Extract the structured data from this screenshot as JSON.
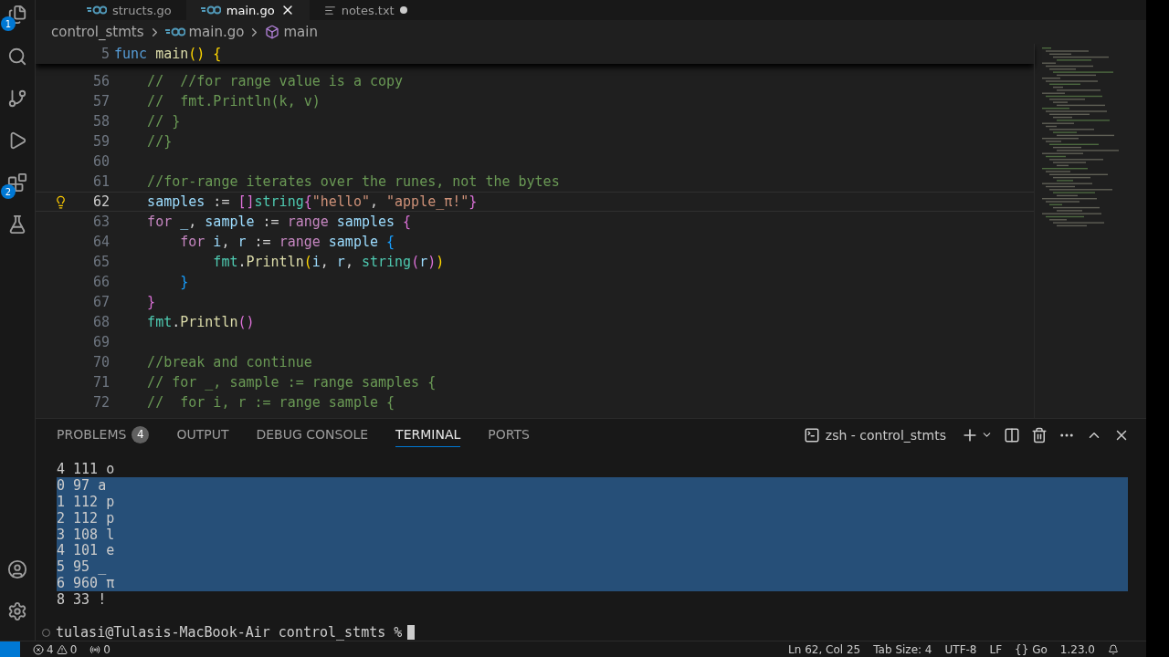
{
  "editor_tabs": [
    {
      "label": "structs.go",
      "kind": "go",
      "selected": false,
      "modified": false
    },
    {
      "label": "main.go",
      "kind": "go",
      "selected": true,
      "modified": false
    },
    {
      "label": "notes.txt",
      "kind": "text",
      "selected": false,
      "modified": true
    }
  ],
  "activity_bar": {
    "explorer_badge": "1",
    "extensions_badge": "2"
  },
  "breadcrumbs": [
    {
      "label": "control_stmts",
      "kind": "folder"
    },
    {
      "label": "main.go",
      "kind": "go"
    },
    {
      "label": "main",
      "kind": "symbol"
    }
  ],
  "sticky_line": {
    "number": "5",
    "tokens": [
      {
        "text": "func",
        "kind": "keyword"
      },
      {
        "text": " main",
        "kind": "function"
      },
      {
        "text": "()",
        "kind": "bracket1"
      },
      {
        "text": " {",
        "kind": "bracket1"
      }
    ]
  },
  "code_lines": [
    {
      "number": "56",
      "current": false,
      "tokens": [
        {
          "text": "    //  //for range value is a copy",
          "kind": "comment"
        }
      ]
    },
    {
      "number": "57",
      "current": false,
      "tokens": [
        {
          "text": "    //  fmt.Println(k, v)",
          "kind": "comment"
        }
      ]
    },
    {
      "number": "58",
      "current": false,
      "tokens": [
        {
          "text": "    // }",
          "kind": "comment"
        }
      ]
    },
    {
      "number": "59",
      "current": false,
      "tokens": [
        {
          "text": "    //}",
          "kind": "comment"
        }
      ]
    },
    {
      "number": "60",
      "current": false
    },
    {
      "number": "61",
      "current": false,
      "tokens": [
        {
          "text": "    //for-range iterates over the runes, not the bytes",
          "kind": "comment"
        }
      ]
    },
    {
      "number": "62",
      "current": true,
      "tokens": [
        {
          "text": "    samples",
          "kind": "variable"
        },
        {
          "text": " := ",
          "kind": "plain"
        },
        {
          "text": "[]",
          "kind": "bracket2"
        },
        {
          "text": "string",
          "kind": "type"
        },
        {
          "text": "{",
          "kind": "bracket2"
        },
        {
          "text": "\"hello\"",
          "kind": "string"
        },
        {
          "text": ", ",
          "kind": "plain"
        },
        {
          "text": "\"apple_π!\"",
          "kind": "string"
        },
        {
          "text": "}",
          "kind": "bracket2"
        }
      ]
    },
    {
      "number": "63",
      "current": false,
      "tokens": [
        {
          "text": "    for",
          "kind": "control"
        },
        {
          "text": " _",
          "kind": "variable"
        },
        {
          "text": ", ",
          "kind": "plain"
        },
        {
          "text": "sample",
          "kind": "variable"
        },
        {
          "text": " := ",
          "kind": "plain"
        },
        {
          "text": "range",
          "kind": "control"
        },
        {
          "text": " samples",
          "kind": "variable"
        },
        {
          "text": " {",
          "kind": "bracket2"
        }
      ]
    },
    {
      "number": "64",
      "current": false,
      "tokens": [
        {
          "text": "        for",
          "kind": "control"
        },
        {
          "text": " i",
          "kind": "variable"
        },
        {
          "text": ", ",
          "kind": "plain"
        },
        {
          "text": "r",
          "kind": "variable"
        },
        {
          "text": " := ",
          "kind": "plain"
        },
        {
          "text": "range",
          "kind": "control"
        },
        {
          "text": " sample",
          "kind": "variable"
        },
        {
          "text": " {",
          "kind": "bracket3"
        }
      ]
    },
    {
      "number": "65",
      "current": false,
      "tokens": [
        {
          "text": "            fmt",
          "kind": "type"
        },
        {
          "text": ".",
          "kind": "plain"
        },
        {
          "text": "Println",
          "kind": "function"
        },
        {
          "text": "(",
          "kind": "bracket1"
        },
        {
          "text": "i",
          "kind": "variable"
        },
        {
          "text": ", ",
          "kind": "plain"
        },
        {
          "text": "r",
          "kind": "variable"
        },
        {
          "text": ", ",
          "kind": "plain"
        },
        {
          "text": "string",
          "kind": "type"
        },
        {
          "text": "(",
          "kind": "bracket2"
        },
        {
          "text": "r",
          "kind": "variable"
        },
        {
          "text": ")",
          "kind": "bracket2"
        },
        {
          "text": ")",
          "kind": "bracket1"
        }
      ]
    },
    {
      "number": "66",
      "current": false,
      "tokens": [
        {
          "text": "        }",
          "kind": "bracket3"
        }
      ]
    },
    {
      "number": "67",
      "current": false,
      "tokens": [
        {
          "text": "    }",
          "kind": "bracket2"
        }
      ]
    },
    {
      "number": "68",
      "current": false,
      "tokens": [
        {
          "text": "    fmt",
          "kind": "type"
        },
        {
          "text": ".",
          "kind": "plain"
        },
        {
          "text": "Println",
          "kind": "function"
        },
        {
          "text": "()",
          "kind": "bracket2"
        }
      ]
    },
    {
      "number": "69",
      "current": false
    },
    {
      "number": "70",
      "current": false,
      "tokens": [
        {
          "text": "    //break and continue",
          "kind": "comment"
        }
      ]
    },
    {
      "number": "71",
      "current": false,
      "tokens": [
        {
          "text": "    // for _, sample := range samples {",
          "kind": "comment"
        }
      ]
    },
    {
      "number": "72",
      "current": false,
      "tokens": [
        {
          "text": "    //  for i, r := range sample {",
          "kind": "comment"
        }
      ]
    }
  ],
  "panel_tabs": [
    {
      "label": "PROBLEMS",
      "badge": "4",
      "selected": false
    },
    {
      "label": "OUTPUT",
      "selected": false
    },
    {
      "label": "DEBUG CONSOLE",
      "selected": false
    },
    {
      "label": "TERMINAL",
      "selected": true
    },
    {
      "label": "PORTS",
      "selected": false
    }
  ],
  "terminal_name": "zsh - control_stmts",
  "terminal_lines": [
    {
      "text": "4 111 o",
      "selected": false
    },
    {
      "text": "0 97 a",
      "selected": true
    },
    {
      "text": "1 112 p",
      "selected": true
    },
    {
      "text": "2 112 p",
      "selected": true
    },
    {
      "text": "3 108 l",
      "selected": true
    },
    {
      "text": "4 101 e",
      "selected": true
    },
    {
      "text": "5 95 _",
      "selected": true
    },
    {
      "text": "6 960 π",
      "selected": true
    },
    {
      "text": "8 33 !",
      "selected": false
    }
  ],
  "prompt": "tulasi@Tulasis-MacBook-Air control_stmts %",
  "status_bar": {
    "errors": "4",
    "warnings": "0",
    "ports": "0",
    "items": [
      "Ln 62, Col 25",
      "Tab Size: 4",
      "UTF-8",
      "LF",
      "{} Go",
      "1.23.0"
    ]
  }
}
